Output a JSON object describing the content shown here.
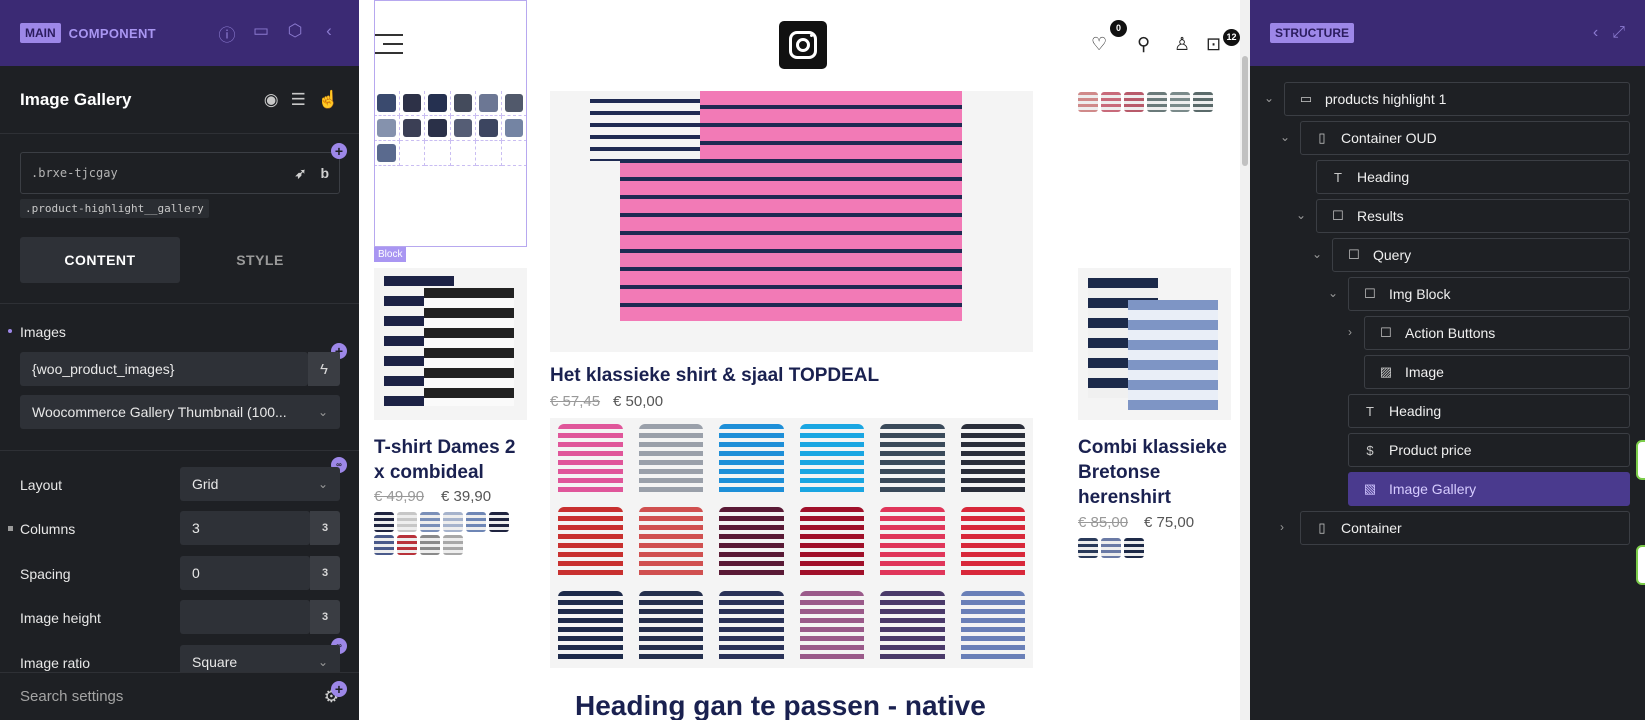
{
  "left_panel": {
    "mode_pill": "MAIN",
    "mode_label": "COMPONENT",
    "element_title": "Image Gallery",
    "selector_value": ".brxe-tjcgay",
    "class_chip": ".product-highlight__gallery",
    "tabs": {
      "content": "CONTENT",
      "style": "STYLE"
    },
    "images_label": "Images",
    "images_value": "{woo_product_images}",
    "image_size_value": "Woocommerce Gallery Thumbnail (100...",
    "layout_label": "Layout",
    "layout_value": "Grid",
    "columns_label": "Columns",
    "columns_value": "3",
    "spacing_label": "Spacing",
    "spacing_value": "0",
    "image_height_label": "Image height",
    "image_height_value": "",
    "image_ratio_label": "Image ratio",
    "image_ratio_value": "Square",
    "search_placeholder": "Search settings"
  },
  "canvas": {
    "wishlist_count": "0",
    "cart_count": "12",
    "block_tag": "Block",
    "products": [
      {
        "title": "T-shirt Dames 2 x combideal",
        "old_price": "€ 49,90",
        "new_price": "€ 39,90"
      },
      {
        "title": "Het klassieke shirt & sjaal TOPDEAL",
        "old_price": "€ 57,45",
        "new_price": "€ 50,00"
      },
      {
        "title": "Combi klassieke Bretonse herenshirt",
        "old_price": "€ 85,00",
        "new_price": "€ 75,00"
      }
    ],
    "bottom_heading": "Heading gan te passen - native"
  },
  "structure": {
    "title": "STRUCTURE",
    "nodes": [
      {
        "label": "products highlight 1",
        "icon": "section-icon"
      },
      {
        "label": "Container OUD",
        "icon": "container-icon"
      },
      {
        "label": "Heading",
        "icon": "heading-icon"
      },
      {
        "label": "Results",
        "icon": "block-icon"
      },
      {
        "label": "Query",
        "icon": "block-icon"
      },
      {
        "label": "Img Block",
        "icon": "block-icon"
      },
      {
        "label": "Action Buttons",
        "icon": "block-icon"
      },
      {
        "label": "Image",
        "icon": "image-icon"
      },
      {
        "label": "Heading",
        "icon": "heading-icon"
      },
      {
        "label": "Product price",
        "icon": "dollar-icon"
      },
      {
        "label": "Image Gallery",
        "icon": "gallery-icon"
      },
      {
        "label": "Container",
        "icon": "container-icon"
      }
    ]
  },
  "colors": {
    "accent": "#9d87e8",
    "topbar": "#3b2a74",
    "panel_bg": "#1e2024",
    "selected_node": "#4a3a8e",
    "product_title": "#1a2150"
  }
}
